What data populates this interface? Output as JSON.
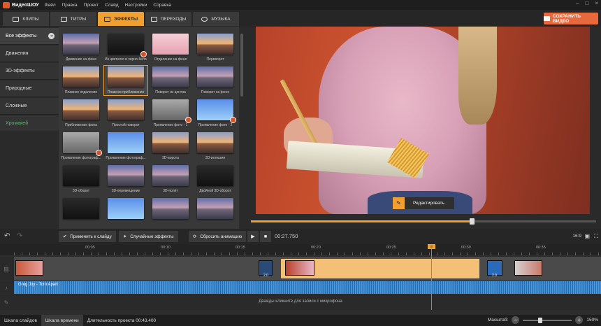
{
  "menubar": {
    "app": "ВидеоШОУ",
    "items": [
      "Файл",
      "Правка",
      "Проект",
      "Слайд",
      "Настройки",
      "Справка"
    ],
    "window_controls": [
      "–",
      "□",
      "×"
    ]
  },
  "tabs": [
    {
      "label": "КЛИПЫ",
      "icon": "clips-icon"
    },
    {
      "label": "ТИТРЫ",
      "icon": "titles-icon"
    },
    {
      "label": "ЭФФЕКТЫ",
      "icon": "effects-icon",
      "active": true
    },
    {
      "label": "ПЕРЕХОДЫ",
      "icon": "transitions-icon"
    },
    {
      "label": "МУЗЫКА",
      "icon": "music-icon"
    }
  ],
  "save_button": "СОХРАНИТЬ ВИДЕО",
  "categories": [
    {
      "label": "Все эффекты",
      "active": true
    },
    {
      "label": "Движения"
    },
    {
      "label": "3D-эффекты"
    },
    {
      "label": "Природные"
    },
    {
      "label": "Сложные"
    },
    {
      "label": "Хромакей",
      "green": true
    }
  ],
  "effects": [
    {
      "label": "Движение на фоне",
      "bg": "sunset"
    },
    {
      "label": "Из цветного в черно-белое",
      "bg": "dark",
      "badge": true
    },
    {
      "label": "Отдаление на фоне",
      "bg": "pink"
    },
    {
      "label": "Переворот",
      "bg": "pier"
    },
    {
      "label": "Плавное отдаление",
      "bg": "pier"
    },
    {
      "label": "Плавное приближение",
      "bg": "pier",
      "selected": true
    },
    {
      "label": "Поворот из центра",
      "bg": "sunset"
    },
    {
      "label": "Поворот на фоне",
      "bg": "sunset"
    },
    {
      "label": "Приближение фона",
      "bg": "pier"
    },
    {
      "label": "Простой поворот",
      "bg": "pier"
    },
    {
      "label": "Проявление фото - 1",
      "bg": "grey",
      "badge": true
    },
    {
      "label": "Проявление фото - 2",
      "bg": "blue",
      "badge": true
    },
    {
      "label": "Проявление фотограф...",
      "bg": "grey",
      "badge": true
    },
    {
      "label": "Проявление фотограф...",
      "bg": "blue"
    },
    {
      "label": "3D-ворота",
      "bg": "pier"
    },
    {
      "label": "3D-иллюзия",
      "bg": "pier"
    },
    {
      "label": "3D-оборот",
      "bg": "dark"
    },
    {
      "label": "3D-перемещение",
      "bg": "sunset"
    },
    {
      "label": "3D-полёт",
      "bg": "sunset"
    },
    {
      "label": "Двойной 3D-оборот",
      "bg": "dark"
    },
    {
      "label": "",
      "bg": "dark"
    },
    {
      "label": "",
      "bg": "blue"
    },
    {
      "label": "",
      "bg": "sunset"
    },
    {
      "label": "",
      "bg": "sunset"
    }
  ],
  "edit_button": "Редактировать",
  "controls": {
    "apply": "Применить к слайду",
    "random": "Случайные эффекты",
    "reset": "Сбросить анимацию",
    "timecode": "00:27.750",
    "ratio": "16:9"
  },
  "playback_progress": 0.64,
  "ruler": [
    "00:05",
    "00:10",
    "00:15",
    "00:20",
    "00:25",
    "00:30",
    "00:35"
  ],
  "timeline": {
    "durations": [
      "2.0",
      "2.0"
    ],
    "audio_name": "Greg Joy - Torn Apart",
    "mic_hint": "Дважды кликните для записи с микрофона"
  },
  "status": {
    "tab1": "Шкала слайдов",
    "tab2": "Шкала времени",
    "duration": "Длительность проекта 00:43.400",
    "zoom_label": "Масштаб:",
    "zoom": "150%"
  },
  "colors": {
    "accent": "#f0a030",
    "save": "#e8693c",
    "chromakey": "#4ec070"
  }
}
